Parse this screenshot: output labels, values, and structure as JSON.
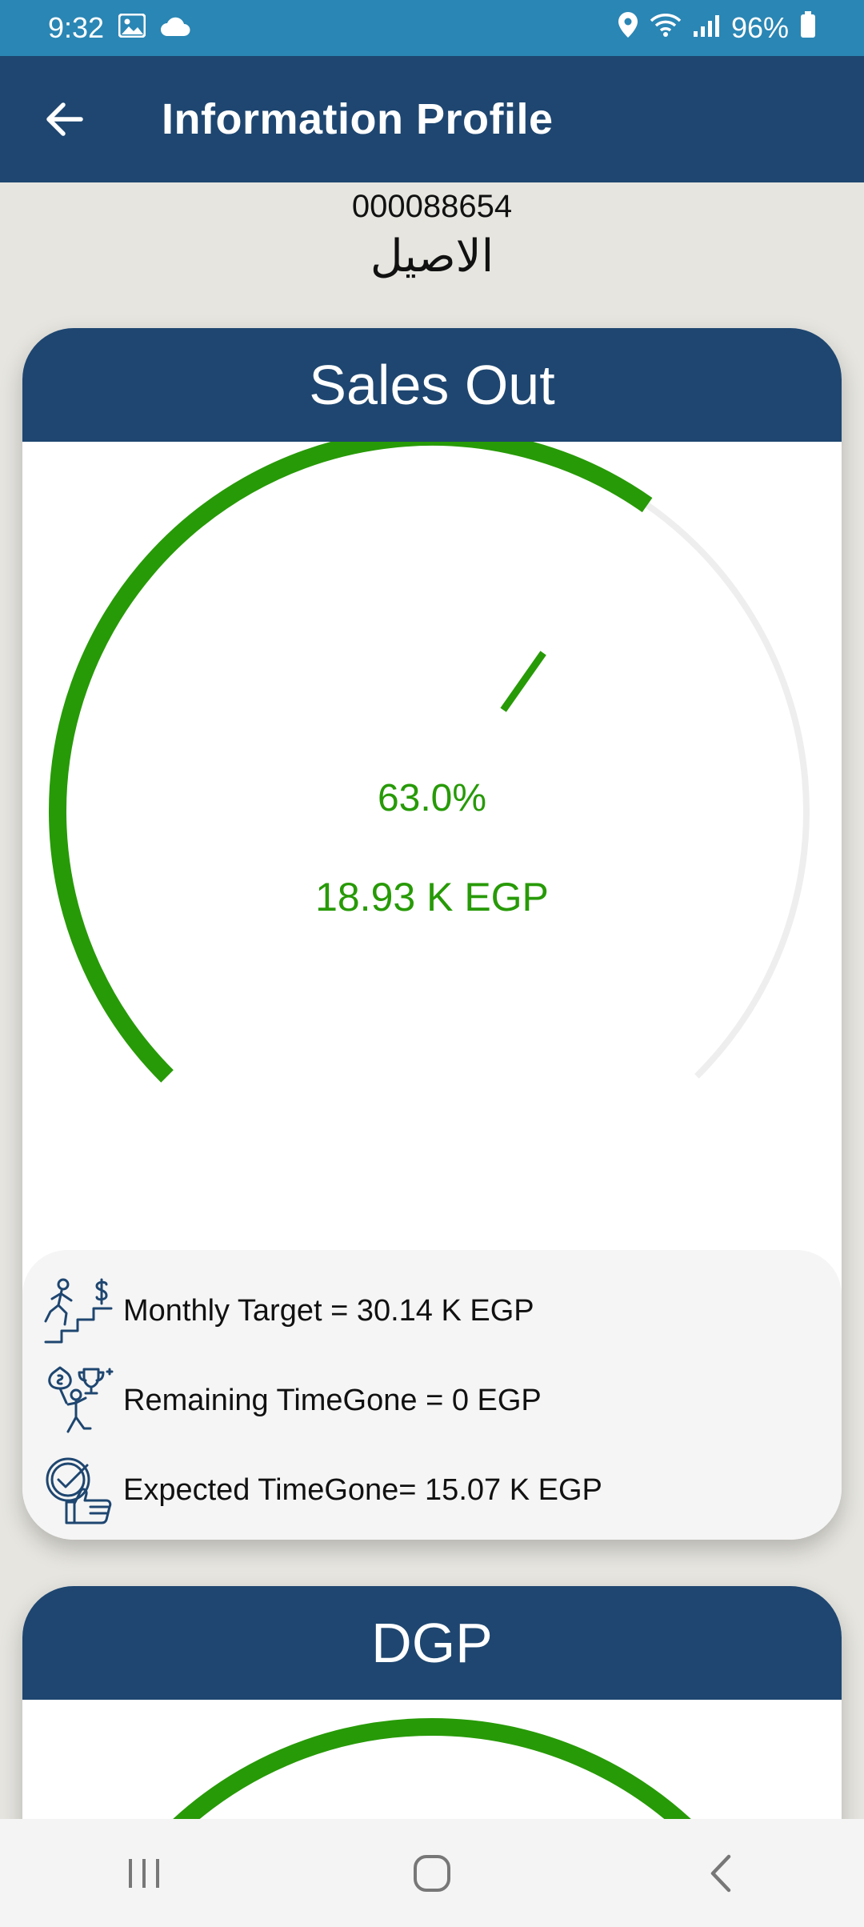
{
  "status": {
    "time": "9:32",
    "battery": "96%"
  },
  "appbar": {
    "title": "Information Profile"
  },
  "customer": {
    "id": "000088654",
    "name": "الاصيل"
  },
  "sales_out": {
    "title": "Sales Out",
    "percent_label": "63.0%",
    "percent_value": 0.63,
    "value_label": "18.93 K EGP",
    "progress_color": "#279a07",
    "track_color": "#eeeeee"
  },
  "info": {
    "monthly_target": "Monthly Target = 30.14 K EGP",
    "remaining_timegone": "Remaining TimeGone = 0 EGP",
    "expected_timegone": "Expected TimeGone= 15.07 K EGP"
  },
  "dgp": {
    "title": "DGP"
  },
  "colors": {
    "status_bar": "#2a86b4",
    "primary": "#1e4670",
    "background": "#e6e5df",
    "accent_green": "#279a07"
  }
}
